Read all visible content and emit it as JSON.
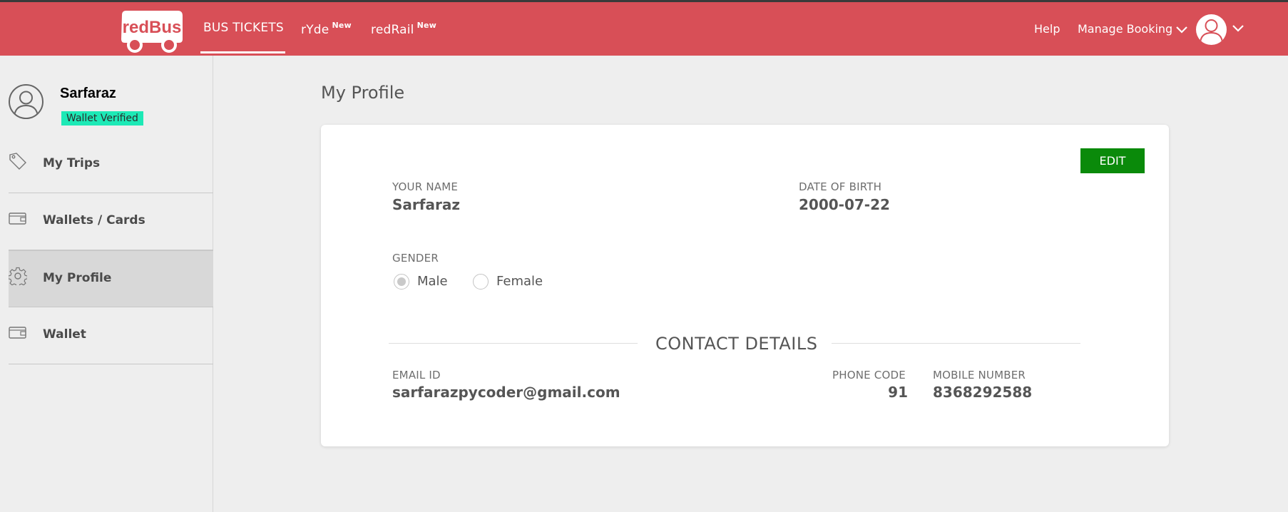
{
  "header": {
    "logo_text": "redBus",
    "nav": [
      {
        "label": "BUS TICKETS",
        "badge": ""
      },
      {
        "label": "rYde",
        "badge": "New"
      },
      {
        "label": "redRail",
        "badge": "New"
      }
    ],
    "help_label": "Help",
    "manage_booking_label": "Manage Booking"
  },
  "sidebar": {
    "user_name": "Sarfaraz",
    "wallet_badge": "Wallet Verified",
    "items": [
      {
        "label": "My Trips",
        "icon": "tag-icon"
      },
      {
        "label": "Wallets / Cards",
        "icon": "wallet-icon"
      },
      {
        "label": "My Profile",
        "icon": "gear-icon"
      },
      {
        "label": "Wallet",
        "icon": "wallet-icon"
      }
    ]
  },
  "main": {
    "title": "My Profile",
    "edit_label": "EDIT",
    "name_label": "YOUR NAME",
    "name_value": "Sarfaraz",
    "dob_label": "DATE OF BIRTH",
    "dob_value": "2000-07-22",
    "gender_label": "GENDER",
    "gender_options": [
      "Male",
      "Female"
    ],
    "gender_selected": "Male",
    "contact_title": "CONTACT DETAILS",
    "email_label": "EMAIL ID",
    "email_value": "sarfarazpycoder@gmail.com",
    "phone_code_label": "PHONE CODE",
    "phone_code_value": "91",
    "mobile_label": "MOBILE NUMBER",
    "mobile_value": "8368292588"
  },
  "colors": {
    "header_bg": "#d84f57",
    "badge_bg": "#1de9b6",
    "edit_bg": "#0a8a0a"
  }
}
